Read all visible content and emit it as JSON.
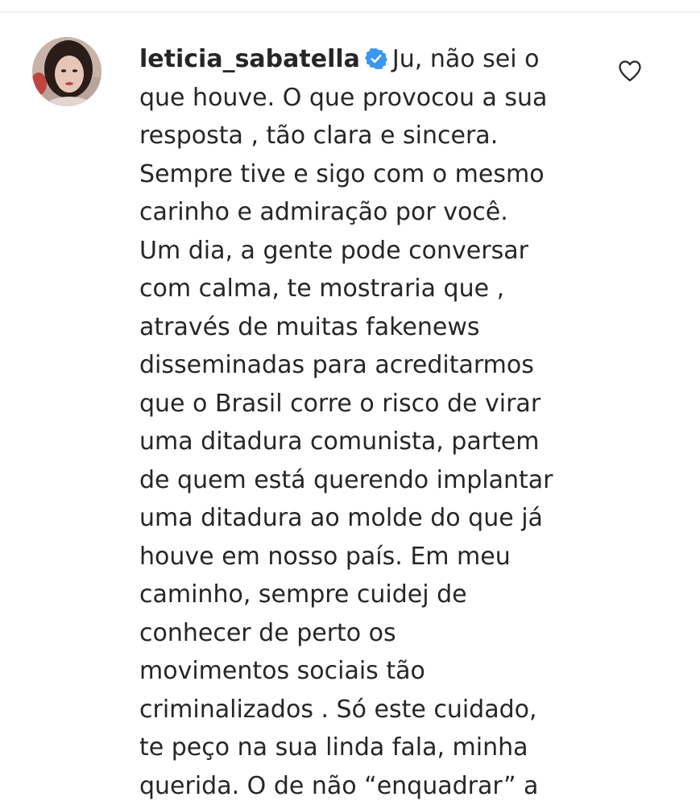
{
  "comment": {
    "username": "leticia_sabatella",
    "verified": true,
    "text": "Ju, não sei o\nque houve. O que provocou a sua\nresposta , tão clara e sincera.\nSempre tive e sigo com o mesmo\ncarinho e admiração por você.\nUm dia, a gente pode conversar\ncom calma, te mostraria que ,\natravés de muitas fakenews\ndisseminadas para acreditarmos\nque o Brasil corre o risco de virar\numa ditadura comunista, partem\nde quem está querendo implantar\numa ditadura ao molde do que já\nhouve em nosso país. Em meu\ncaminho, sempre cuidej de\nconhecer de perto os\nmovimentos sociais tão\ncriminalizados . Só este cuidado,\nte peço na sua linda fala, minha\nquerida. O de não “enquadrar” a"
  },
  "icons": {
    "verified": "verified-badge-icon",
    "like": "heart-outline-icon"
  },
  "colors": {
    "text": "#262626",
    "verified_blue": "#3897f0",
    "divider": "#efefef",
    "icon_outline": "#262626"
  }
}
